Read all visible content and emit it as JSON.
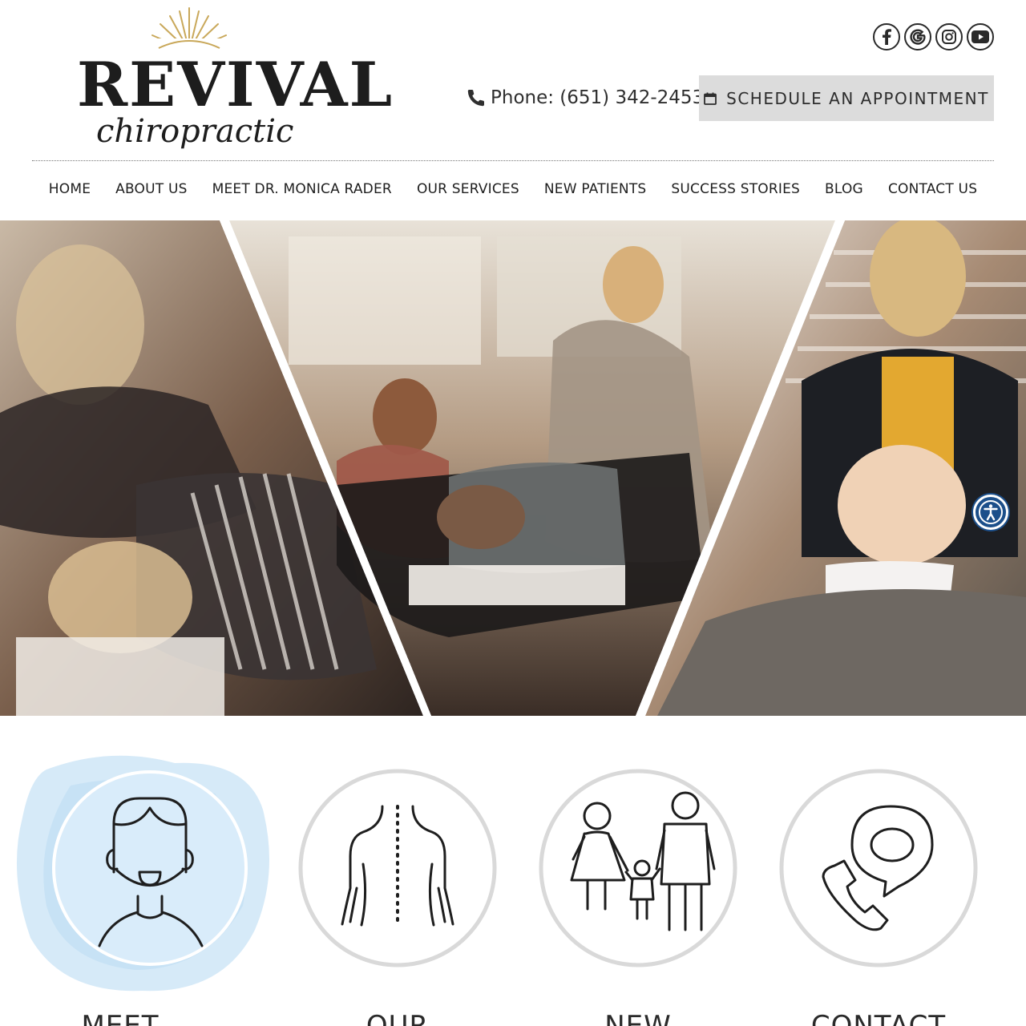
{
  "brand": {
    "name": "REVIVAL",
    "tagline": "chiropractic",
    "colors": {
      "accent_gold": "#c9a85a",
      "text_dark": "#1d1d1d",
      "button_gray": "#dcdcdc",
      "circle_gray": "#d9d9d9",
      "watercolor_blue": "#cfe6f7",
      "accessibility_blue": "#1c4f8a"
    }
  },
  "header": {
    "socials": [
      {
        "name": "facebook",
        "icon": "facebook-icon"
      },
      {
        "name": "google",
        "icon": "google-icon"
      },
      {
        "name": "instagram",
        "icon": "instagram-icon"
      },
      {
        "name": "youtube",
        "icon": "youtube-icon"
      }
    ],
    "phone_label": "Phone: (651) 342-2453",
    "appointment_label": "SCHEDULE AN APPOINTMENT"
  },
  "nav": {
    "items": [
      {
        "label": "HOME"
      },
      {
        "label": "ABOUT US"
      },
      {
        "label": "MEET DR. MONICA RADER"
      },
      {
        "label": "OUR SERVICES"
      },
      {
        "label": "NEW PATIENTS"
      },
      {
        "label": "SUCCESS STORIES"
      },
      {
        "label": "BLOG"
      },
      {
        "label": "CONTACT US"
      }
    ]
  },
  "hero": {
    "panels": [
      "adjustment-photo",
      "family-photo",
      "baby-photo"
    ]
  },
  "accessibility": {
    "icon": "accessibility-icon"
  },
  "features": [
    {
      "label": "MEET",
      "icon": "doctor-icon",
      "active": true
    },
    {
      "label": "OUR",
      "icon": "spine-icon",
      "active": false
    },
    {
      "label": "NEW",
      "icon": "family-icon",
      "active": false
    },
    {
      "label": "CONTACT",
      "icon": "phone-location-icon",
      "active": false
    }
  ]
}
